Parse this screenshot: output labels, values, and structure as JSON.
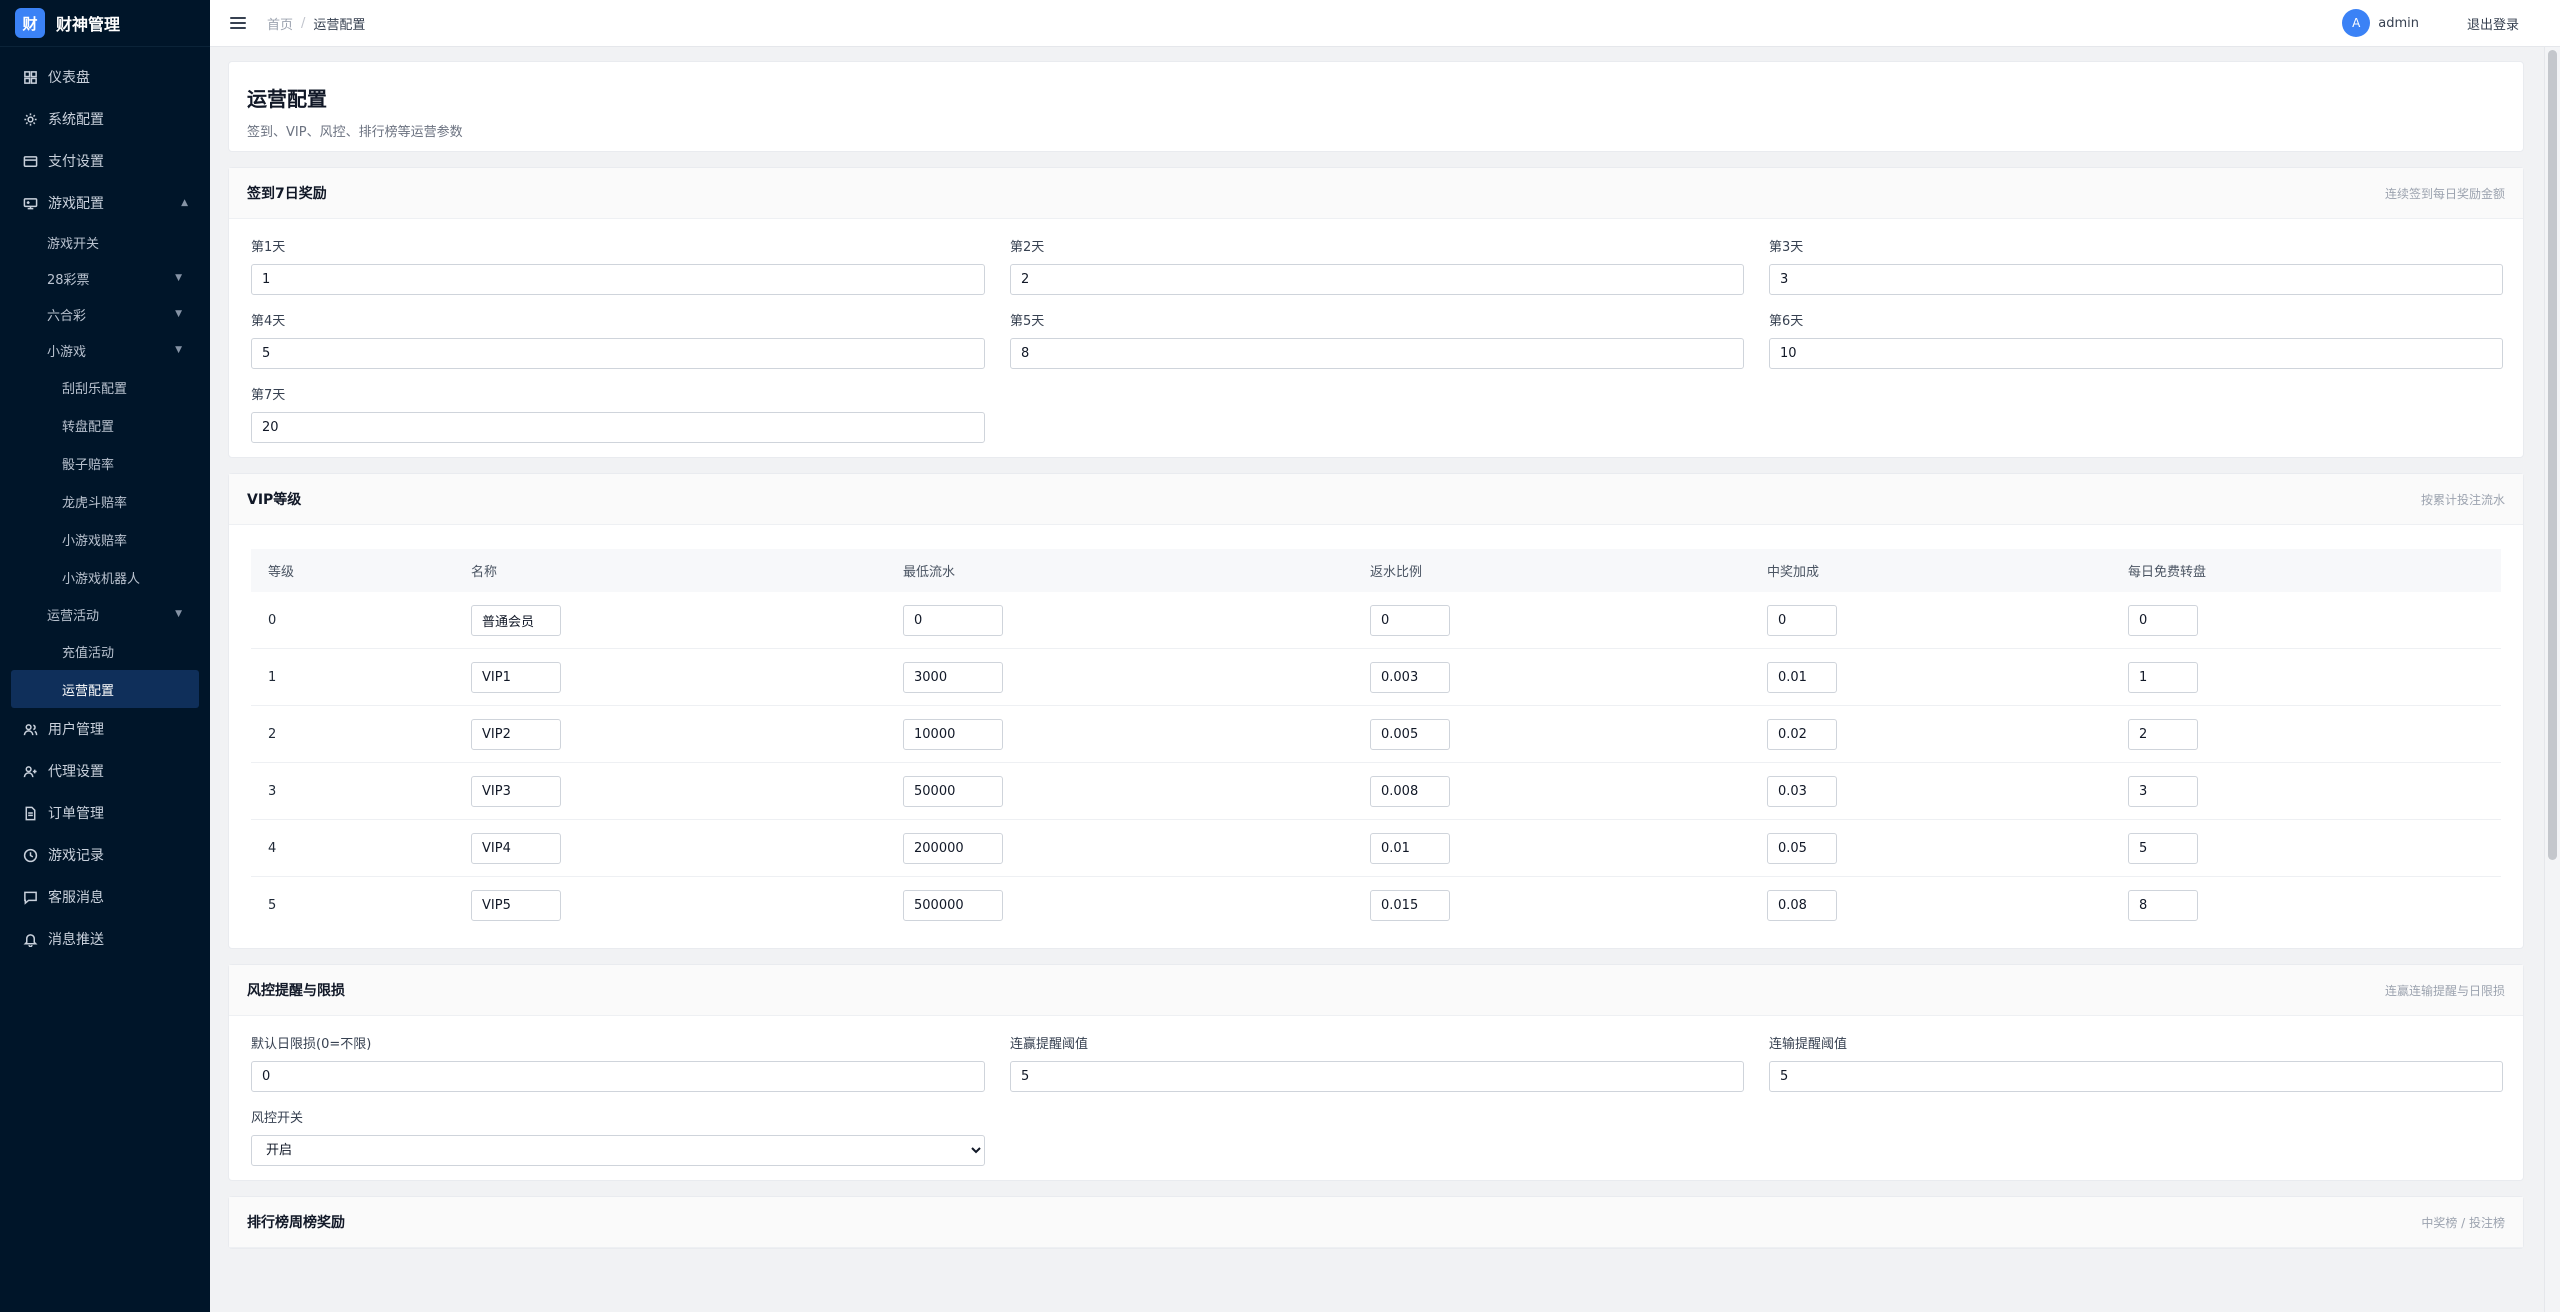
{
  "brand": {
    "logo": "财",
    "name": "财神管理"
  },
  "sidebar": {
    "items": [
      {
        "label": "仪表盘",
        "icon": "grid-icon"
      },
      {
        "label": "系统配置",
        "icon": "gear-icon"
      },
      {
        "label": "支付设置",
        "icon": "card-icon"
      },
      {
        "label": "游戏配置",
        "icon": "gamepad-icon",
        "expanded": true
      }
    ],
    "game_sub": {
      "switch": "游戏开关",
      "lottery28": "28彩票",
      "liuhecai": "六合彩",
      "minigame": "小游戏",
      "minigame_items": [
        "刮刮乐配置",
        "转盘配置",
        "骰子赔率",
        "龙虎斗赔率",
        "小游戏赔率",
        "小游戏机器人"
      ],
      "activity": "运营活动",
      "activity_items": [
        "充值活动",
        "运营配置"
      ]
    },
    "bottom_items": [
      {
        "label": "用户管理",
        "icon": "users-icon"
      },
      {
        "label": "代理设置",
        "icon": "agent-icon"
      },
      {
        "label": "订单管理",
        "icon": "file-icon"
      },
      {
        "label": "游戏记录",
        "icon": "clock-icon"
      },
      {
        "label": "客服消息",
        "icon": "chat-icon"
      },
      {
        "label": "消息推送",
        "icon": "bell-icon"
      }
    ]
  },
  "topbar": {
    "breadcrumb": {
      "home": "首页",
      "sep": "/",
      "current": "运营配置"
    },
    "avatar": "A",
    "username": "admin",
    "logout": "退出登录"
  },
  "page": {
    "title": "运营配置",
    "desc": "签到、VIP、风控、排行榜等运营参数"
  },
  "signin": {
    "title": "签到7日奖励",
    "hint": "连续签到每日奖励金额",
    "days": [
      {
        "label": "第1天",
        "value": "1"
      },
      {
        "label": "第2天",
        "value": "2"
      },
      {
        "label": "第3天",
        "value": "3"
      },
      {
        "label": "第4天",
        "value": "5"
      },
      {
        "label": "第5天",
        "value": "8"
      },
      {
        "label": "第6天",
        "value": "10"
      },
      {
        "label": "第7天",
        "value": "20"
      }
    ]
  },
  "vip": {
    "title": "VIP等级",
    "hint": "按累计投注流水",
    "columns": [
      "等级",
      "名称",
      "最低流水",
      "返水比例",
      "中奖加成",
      "每日免费转盘"
    ],
    "rows": [
      {
        "level": "0",
        "name": "普通会员",
        "min_flow": "0",
        "rebate": "0",
        "bonus": "0",
        "spins": "0"
      },
      {
        "level": "1",
        "name": "VIP1",
        "min_flow": "3000",
        "rebate": "0.003",
        "bonus": "0.01",
        "spins": "1"
      },
      {
        "level": "2",
        "name": "VIP2",
        "min_flow": "10000",
        "rebate": "0.005",
        "bonus": "0.02",
        "spins": "2"
      },
      {
        "level": "3",
        "name": "VIP3",
        "min_flow": "50000",
        "rebate": "0.008",
        "bonus": "0.03",
        "spins": "3"
      },
      {
        "level": "4",
        "name": "VIP4",
        "min_flow": "200000",
        "rebate": "0.01",
        "bonus": "0.05",
        "spins": "5"
      },
      {
        "level": "5",
        "name": "VIP5",
        "min_flow": "500000",
        "rebate": "0.015",
        "bonus": "0.08",
        "spins": "8"
      }
    ]
  },
  "risk": {
    "title": "风控提醒与限损",
    "hint": "连赢连输提醒与日限损",
    "daily_limit": {
      "label": "默认日限损(0=不限)",
      "value": "0"
    },
    "win_streak": {
      "label": "连赢提醒阈值",
      "value": "5"
    },
    "lose_streak": {
      "label": "连输提醒阈值",
      "value": "5"
    },
    "switch": {
      "label": "风控开关",
      "value": "开启"
    }
  },
  "rank": {
    "title": "排行榜周榜奖励",
    "hint": "中奖榜 / 投注榜"
  }
}
